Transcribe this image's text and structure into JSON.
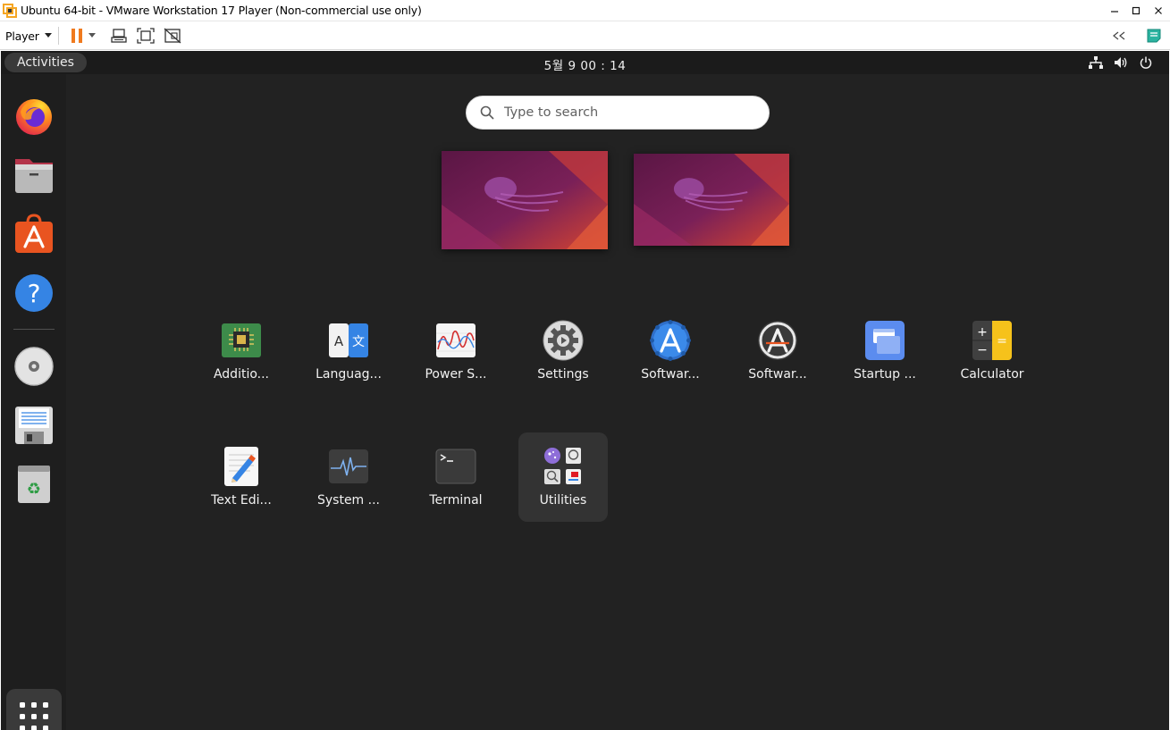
{
  "window": {
    "title": "Ubuntu 64-bit - VMware Workstation 17 Player (Non-commercial use only)",
    "icons": [
      "vmware-icon",
      "minimize-icon",
      "maximize-icon",
      "close-icon"
    ]
  },
  "toolbar": {
    "player_label": "Player",
    "buttons": [
      "pause-icon",
      "dropdown-arrow-icon",
      "send-ctrl-alt-del-icon",
      "full-screen-icon",
      "unity-icon",
      "collapse-toolbar-icon",
      "message-log-icon"
    ]
  },
  "guest": {
    "topbar": {
      "activities_label": "Activities",
      "clock": "5월 9  00 : 14",
      "status_icons": [
        "network-icon",
        "volume-icon",
        "power-icon"
      ]
    },
    "search": {
      "placeholder": "Type to search"
    },
    "dock": {
      "items": [
        {
          "name": "firefox",
          "icon": "firefox-icon"
        },
        {
          "name": "files",
          "icon": "files-icon"
        },
        {
          "name": "ubuntu-software",
          "icon": "software-store-icon"
        },
        {
          "name": "help",
          "icon": "help-icon"
        },
        {
          "name": "cd-drive",
          "icon": "cd-drive-icon"
        },
        {
          "name": "floppy-drive",
          "icon": "floppy-drive-icon"
        },
        {
          "name": "trash",
          "icon": "trash-icon"
        }
      ],
      "show_apps_icon": "app-grid-icon"
    },
    "workspaces": [
      "workspace-1",
      "workspace-2"
    ],
    "apps": [
      {
        "label": "Additio...",
        "icon": "chip-icon",
        "row": 1
      },
      {
        "label": "Languag...",
        "icon": "language-icon",
        "row": 1
      },
      {
        "label": "Power S...",
        "icon": "power-statistics-icon",
        "row": 1
      },
      {
        "label": "Settings",
        "icon": "settings-gear-icon",
        "row": 1
      },
      {
        "label": "Softwar...",
        "icon": "software-updater-icon",
        "row": 1
      },
      {
        "label": "Softwar...",
        "icon": "software-properties-icon",
        "row": 1
      },
      {
        "label": "Startup ...",
        "icon": "startup-disk-icon",
        "row": 1
      },
      {
        "label": "Calculator",
        "icon": "calculator-icon",
        "row": 1
      },
      {
        "label": "Text Edi...",
        "icon": "text-editor-icon",
        "row": 2
      },
      {
        "label": "System ...",
        "icon": "system-monitor-icon",
        "row": 2
      },
      {
        "label": "Terminal",
        "icon": "terminal-icon",
        "row": 2
      },
      {
        "label": "Utilities",
        "icon": "utilities-folder-icon",
        "row": 2,
        "selected": true
      }
    ],
    "colors": {
      "background": "#222222",
      "topbar": "#1b1b1b",
      "dock": "#1e1e1e",
      "accent_orange": "#e95420",
      "wallpaper_purple": "#77216f"
    }
  }
}
